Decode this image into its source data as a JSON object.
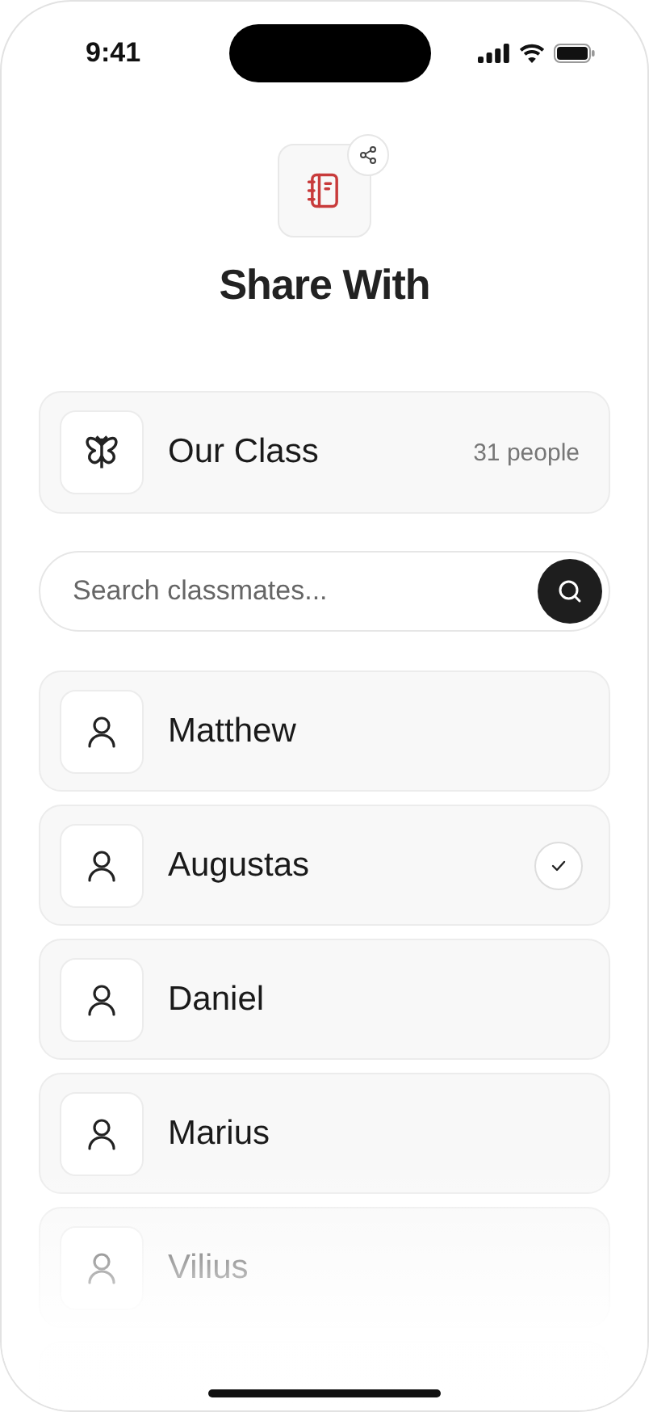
{
  "status_bar": {
    "time": "9:41"
  },
  "title": "Share With",
  "group": {
    "name": "Our Class",
    "count": "31 people"
  },
  "search": {
    "placeholder": "Search classmates..."
  },
  "classmates": [
    {
      "name": "Matthew",
      "selected": false
    },
    {
      "name": "Augustas",
      "selected": true
    },
    {
      "name": "Daniel",
      "selected": false
    },
    {
      "name": "Marius",
      "selected": false
    },
    {
      "name": "Vilius",
      "selected": false
    }
  ]
}
